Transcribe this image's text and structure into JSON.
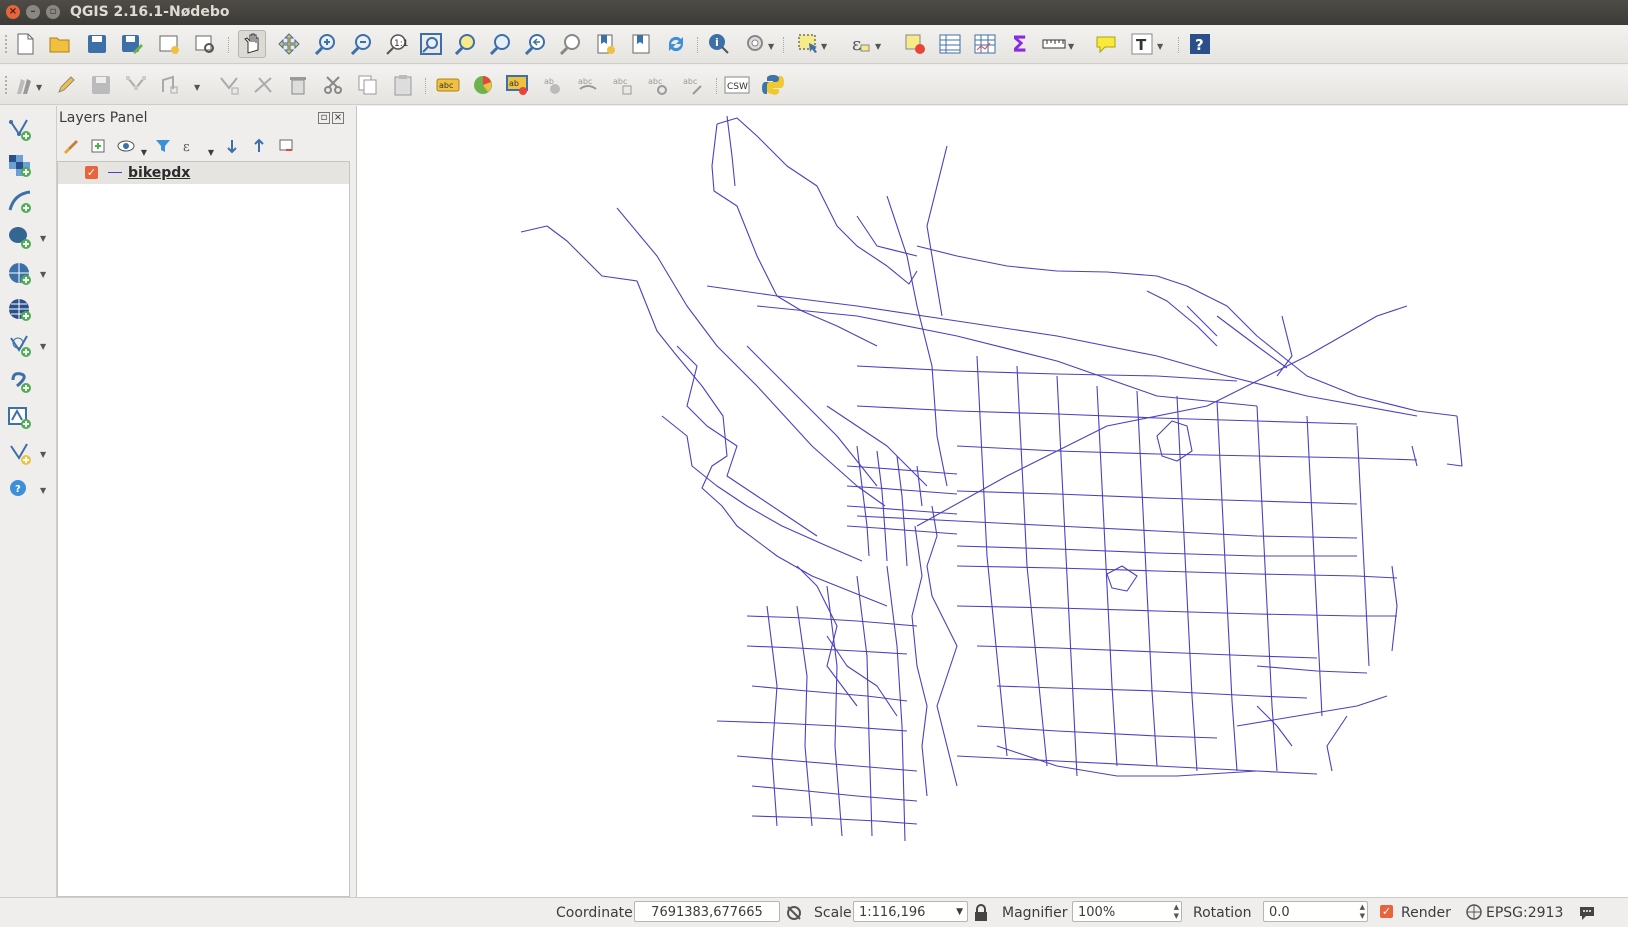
{
  "window": {
    "title": "QGIS 2.16.1-Nødebo"
  },
  "layers_panel": {
    "title": "Layers Panel",
    "layers": [
      {
        "name": "bikepdx",
        "visible": true,
        "symbol_color": "#4a41c4"
      }
    ]
  },
  "map": {
    "line_color": "#4a41c4",
    "background": "#ffffff"
  },
  "statusbar": {
    "coordinate_label": "Coordinate",
    "coordinate_value": "7691383,677665",
    "scale_label": "Scale",
    "scale_value": "1:116,196",
    "magnifier_label": "Magnifier",
    "magnifier_value": "100%",
    "rotation_label": "Rotation",
    "rotation_value": "0.0",
    "render_label": "Render",
    "crs": "EPSG:2913"
  },
  "icons": {
    "toolbar1": [
      "new-project-icon",
      "open-project-icon",
      "save-project-icon",
      "save-as-icon",
      "new-print-composer-icon",
      "composer-manager-icon",
      "pan-icon",
      "pan-to-selection-icon",
      "zoom-in-icon",
      "zoom-out-icon",
      "zoom-actual-icon",
      "zoom-full-icon",
      "zoom-to-selection-icon",
      "zoom-to-layer-icon",
      "zoom-last-icon",
      "zoom-next-icon",
      "new-bookmark-icon",
      "show-bookmarks-icon",
      "refresh-icon",
      "identify-icon",
      "run-action-icon",
      "select-features-icon",
      "select-by-expression-icon",
      "deselect-icon",
      "attribute-table-icon",
      "field-calculator-icon",
      "statistics-icon",
      "measure-icon",
      "map-tips-icon",
      "text-annotation-icon",
      "help-icon"
    ],
    "toolbar2": [
      "current-edits-icon",
      "toggle-editing-icon",
      "save-edits-icon",
      "add-feature-icon",
      "move-feature-icon",
      "node-tool-icon",
      "delete-selected-icon",
      "cut-features-icon",
      "copy-features-icon",
      "paste-features-icon",
      "label-icon",
      "diagram-icon",
      "pin-labels-icon",
      "show-hide-labels-icon",
      "move-label-icon",
      "rotate-label-icon",
      "change-label-icon",
      "csw-icon",
      "python-console-icon"
    ],
    "lefttools": [
      "add-vector-layer-icon",
      "add-raster-layer-icon",
      "add-spatialite-layer-icon",
      "add-postgis-layer-icon",
      "add-wms-layer-icon",
      "add-wcs-layer-icon",
      "add-wfs-layer-icon",
      "add-delimited-text-icon",
      "add-virtual-layer-icon",
      "new-shapefile-layer-icon",
      "add-mssql-layer-icon"
    ]
  },
  "toolbar2_labels": {
    "csw": "CSW"
  }
}
